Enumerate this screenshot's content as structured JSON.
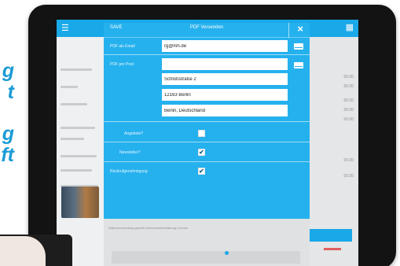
{
  "tagline_fragments": [
    "g",
    "t",
    "g",
    "ft"
  ],
  "app": {
    "menu_icon": "menu-icon",
    "right_icon": "grid-icon",
    "numbers": [
      "00.00",
      "00.00",
      "00.00",
      "00.00",
      "00.00",
      "00.00",
      "00.00"
    ]
  },
  "modal": {
    "save_label": "SAVE",
    "title": "PDF Versenden",
    "close_label": "×",
    "email_label": "PDF als Email",
    "email_value": "rg@mh.de",
    "post_label": "PDF per Post",
    "address": [
      "",
      "Schloßstraße 2",
      "12163 Berlin",
      "Berlin, Deutschland"
    ],
    "angebot_label": "Angebote?",
    "newsletter_label": "Newsletter?",
    "rueckruf_label": "Rückrufgenehmigung",
    "angebot_checked": false,
    "newsletter_checked": true,
    "rueckruf_checked": true,
    "checkmark": "✔",
    "disclaimer": "Datenverwendung gemäß Datenschutzerklärung | Kunde"
  },
  "colors": {
    "accent": "#25b1ee",
    "appbar": "#19a8e8",
    "tagline": "#1a9bd6",
    "tablet_frame": "#131313"
  }
}
